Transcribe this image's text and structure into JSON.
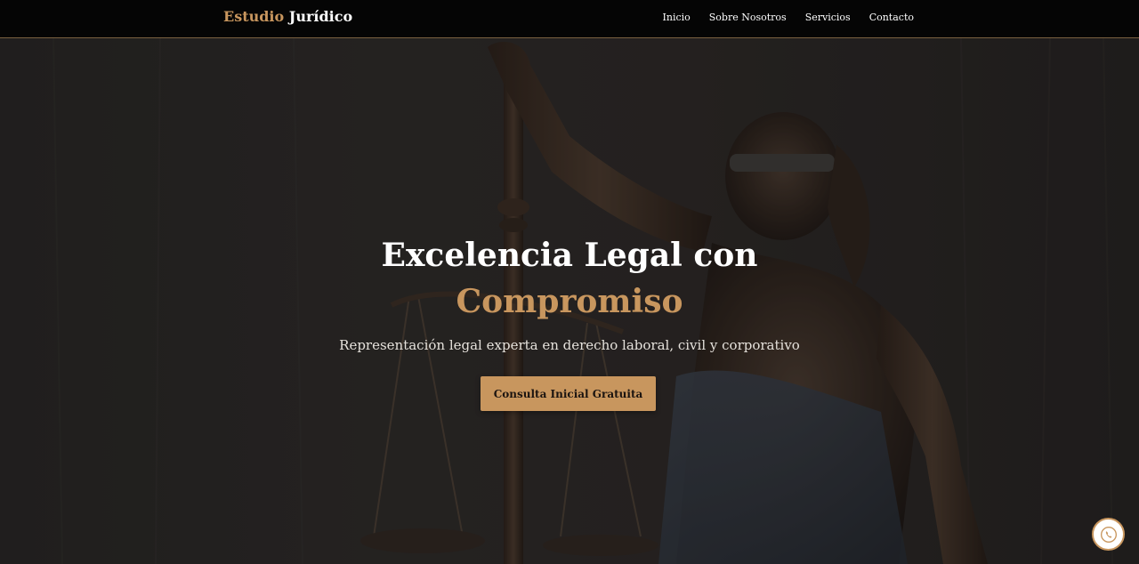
{
  "nav": {
    "brand_accent": "Estudio",
    "brand_main": "Jurídico",
    "links": [
      {
        "label": "Inicio"
      },
      {
        "label": "Sobre Nosotros"
      },
      {
        "label": "Servicios"
      },
      {
        "label": "Contacto"
      }
    ]
  },
  "hero": {
    "title_line1": "Excelencia Legal con",
    "title_line2": "Compromiso",
    "subtitle": "Representación legal experta en derecho laboral, civil y corporativo",
    "cta_label": "Consulta Inicial Gratuita",
    "background_image": "lady-justice-statue-icon"
  },
  "floating_button": {
    "icon": "phone-icon"
  },
  "colors": {
    "accent": "#c8965e",
    "navbar_bg": "#050505",
    "text_light": "#ffffff"
  }
}
